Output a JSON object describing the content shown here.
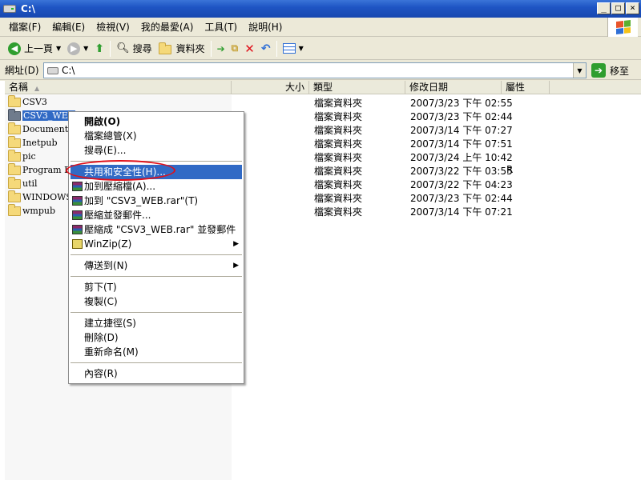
{
  "window": {
    "title": "C:\\",
    "minimize": "_",
    "maximize": "□",
    "close": "×"
  },
  "menubar": [
    "檔案(F)",
    "編輯(E)",
    "檢視(V)",
    "我的最愛(A)",
    "工具(T)",
    "說明(H)"
  ],
  "toolbar": {
    "back_label": "上一頁",
    "search_label": "搜尋",
    "folders_label": "資料夾"
  },
  "address": {
    "label": "網址(D)",
    "value": "C:\\",
    "go_label": "移至"
  },
  "columns": {
    "name": "名稱",
    "size": "大小",
    "type": "類型",
    "modified": "修改日期",
    "attributes": "屬性"
  },
  "rows": [
    {
      "name": "CSV3",
      "type": "檔案資料夾",
      "date": "2007/3/23 下午 02:55",
      "attr": ""
    },
    {
      "name": "CSV3_WEB",
      "type": "檔案資料夾",
      "date": "2007/3/23 下午 02:44",
      "attr": ""
    },
    {
      "name": "Documents and Settings",
      "type": "檔案資料夾",
      "date": "2007/3/14 下午 07:27",
      "attr": ""
    },
    {
      "name": "Inetpub",
      "type": "檔案資料夾",
      "date": "2007/3/14 下午 07:51",
      "attr": ""
    },
    {
      "name": "pic",
      "type": "檔案資料夾",
      "date": "2007/3/24 上午 10:42",
      "attr": ""
    },
    {
      "name": "Program Files",
      "type": "檔案資料夾",
      "date": "2007/3/22 下午 03:55",
      "attr": "R"
    },
    {
      "name": "util",
      "type": "檔案資料夾",
      "date": "2007/3/22 下午 04:23",
      "attr": ""
    },
    {
      "name": "WINDOWS",
      "type": "檔案資料夾",
      "date": "2007/3/23 下午 02:44",
      "attr": ""
    },
    {
      "name": "wmpub",
      "type": "檔案資料夾",
      "date": "2007/3/14 下午 07:21",
      "attr": ""
    }
  ],
  "context_menu": {
    "open": "開啟(O)",
    "explore": "檔案總管(X)",
    "search": "搜尋(E)...",
    "sharing": "共用和安全性(H)...",
    "add_archive": "加到壓縮檔(A)...",
    "add_rar": "加到 \"CSV3_WEB.rar\"(T)",
    "compress_email": "壓縮並發郵件...",
    "compress_rar_email": "壓縮成 \"CSV3_WEB.rar\" 並發郵件",
    "winzip": "WinZip(Z)",
    "send_to": "傳送到(N)",
    "cut": "剪下(T)",
    "copy": "複製(C)",
    "create_shortcut": "建立捷徑(S)",
    "delete": "刪除(D)",
    "rename": "重新命名(M)",
    "properties": "內容(R)"
  },
  "colors": {
    "titlebar": "#1f55c4",
    "selection": "#316ac5",
    "annotation": "#e0101a"
  }
}
